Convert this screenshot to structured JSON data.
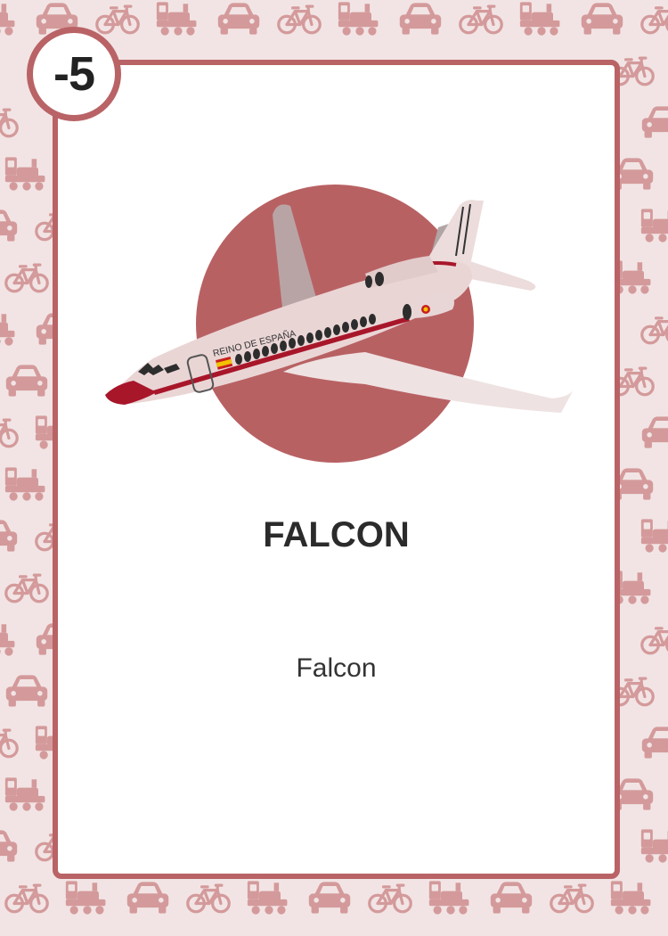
{
  "card": {
    "value": "-5",
    "title": "FALCON",
    "subtitle": "Falcon",
    "aircraft_livery_text": "REINO DE ESPAÑA"
  },
  "background": {
    "pattern_icons": [
      "train-icon",
      "car-icon",
      "bicycle-icon"
    ]
  },
  "colors": {
    "background": "#f2e4e4",
    "pattern": "#d49a9b",
    "frame": "#b96366",
    "sun_circle": "#b86163",
    "fuselage": "#ead5d5",
    "stripe": "#a8162a",
    "card_face": "#ffffff"
  }
}
